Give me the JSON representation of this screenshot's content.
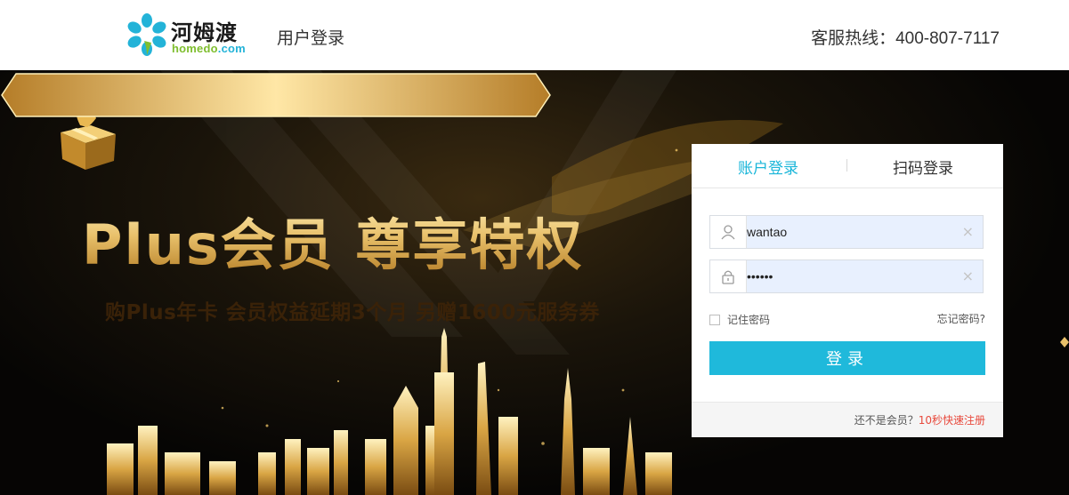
{
  "header": {
    "logo_cn": "河姆渡",
    "logo_en_part1": "homedo",
    "logo_en_part2": ".com",
    "page_name": "用户登录",
    "hotline": "客服热线：400-807-7117"
  },
  "banner": {
    "headline": "Plus会员 尊享特权",
    "subline": "购Plus年卡 会员权益延期3个月 另赠1600元服务券"
  },
  "login": {
    "tabs": [
      {
        "label": "账户登录",
        "active": true
      },
      {
        "label": "扫码登录",
        "active": false
      }
    ],
    "username_value": "wantao",
    "password_value": "••••••",
    "clear_icon": "×",
    "remember_label": "记住密码",
    "remember_checked": false,
    "forgot_label": "忘记密码?",
    "submit_label": "登录",
    "footer_text": "还不是会员？",
    "register_label": "10秒快速注册"
  },
  "colors": {
    "accent": "#1fb9db",
    "link_red": "#e8493c",
    "gold": "#e4b85a"
  },
  "icons": {
    "logo": "flower-logo-icon",
    "user": "user-icon",
    "lock": "lock-icon",
    "clear": "close-icon",
    "gift": "gift-box-icon"
  }
}
